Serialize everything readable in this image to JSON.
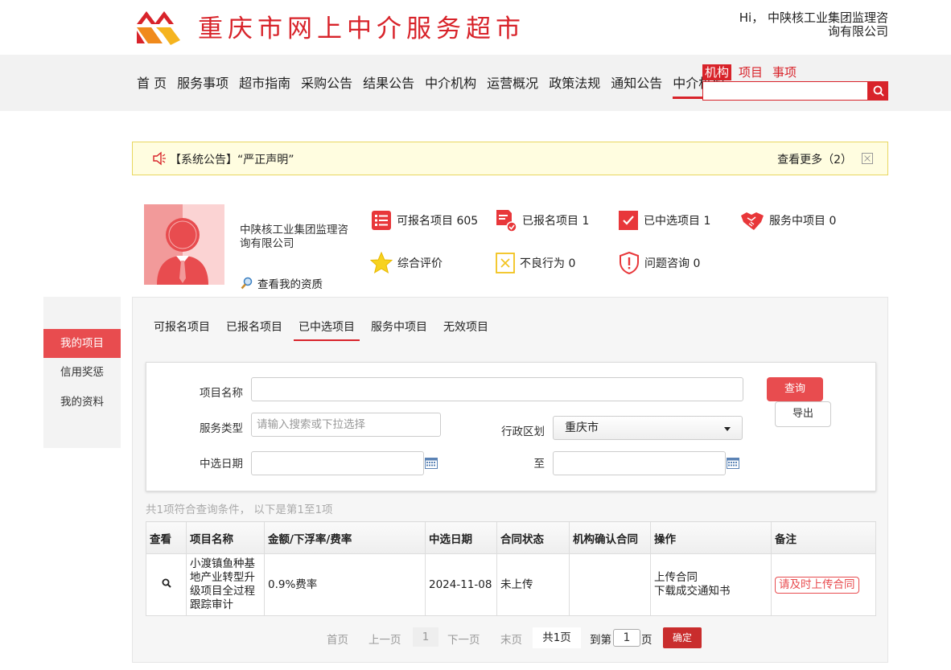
{
  "header": {
    "site_title": "重庆市网上中介服务超市",
    "greeting": "Hi， 中陕核工业集团监理咨询有限公司"
  },
  "nav": {
    "items": [
      "首 页",
      "服务事项",
      "超市指南",
      "采购公告",
      "结果公告",
      "中介机构",
      "运营概况",
      "政策法规",
      "通知公告",
      "中介机构"
    ],
    "active_index": 9
  },
  "search": {
    "tabs": [
      "机构",
      "项目",
      "事项"
    ],
    "active_tab": 0,
    "placeholder": ""
  },
  "notice": {
    "text": "【系统公告】“严正声明”",
    "more": "查看更多（2）"
  },
  "profile": {
    "company_name": "中陕核工业集团监理咨询有限公司",
    "qual_link": "查看我的资质",
    "stats": [
      {
        "label": "可报名项目 605",
        "icon": "list-icon"
      },
      {
        "label": "已报名项目 1",
        "icon": "document-check-icon"
      },
      {
        "label": "已中选项目 1",
        "icon": "checkbox-icon"
      },
      {
        "label": "服务中项目 0",
        "icon": "handshake-icon"
      },
      {
        "label": "综合评价",
        "icon": "star-icon"
      },
      {
        "label": "不良行为 0",
        "icon": "cross-box-icon"
      },
      {
        "label": "问题咨询 0",
        "icon": "shield-alert-icon"
      }
    ]
  },
  "sidebar": {
    "items": [
      "我的项目",
      "信用奖惩",
      "我的资料"
    ],
    "active_index": 0
  },
  "tabs": {
    "items": [
      "可报名项目",
      "已报名项目",
      "已中选项目",
      "服务中项目",
      "无效项目"
    ],
    "active_index": 2
  },
  "form": {
    "project_name_label": "项目名称",
    "project_name_value": "",
    "service_type_label": "服务类型",
    "service_type_placeholder": "请输入搜索或下拉选择",
    "region_label": "行政区划",
    "region_value": "重庆市",
    "date_label": "中选日期",
    "date_to_label": "至",
    "query_button": "查询",
    "export_button": "导出"
  },
  "result_info": "共1项符合查询条件， 以下是第1至1项",
  "table": {
    "headers": [
      "查看",
      "项目名称",
      "金额/下浮率/费率",
      "中选日期",
      "合同状态",
      "机构确认合同",
      "操作",
      "备注"
    ],
    "rows": [
      {
        "project_name": "小渡镇鱼种基地产业转型升级项目全过程跟踪审计",
        "amount": "0.9%费率",
        "date": "2024-11-08",
        "contract_status": "未上传",
        "agency_confirm": "",
        "action_upload": "上传合同",
        "action_download": "下载成交通知书",
        "remark": "请及时上传合同"
      }
    ]
  },
  "pager": {
    "first": "首页",
    "prev": "上一页",
    "current": "1",
    "next": "下一页",
    "last": "末页",
    "total": "共1页",
    "goto_prefix": "到第",
    "goto_value": "1",
    "goto_suffix": "页",
    "confirm": "确定"
  },
  "colors": {
    "brand_red": "#d8232a",
    "accent_red": "#e84c4f",
    "notice_bg": "#fffde0"
  }
}
